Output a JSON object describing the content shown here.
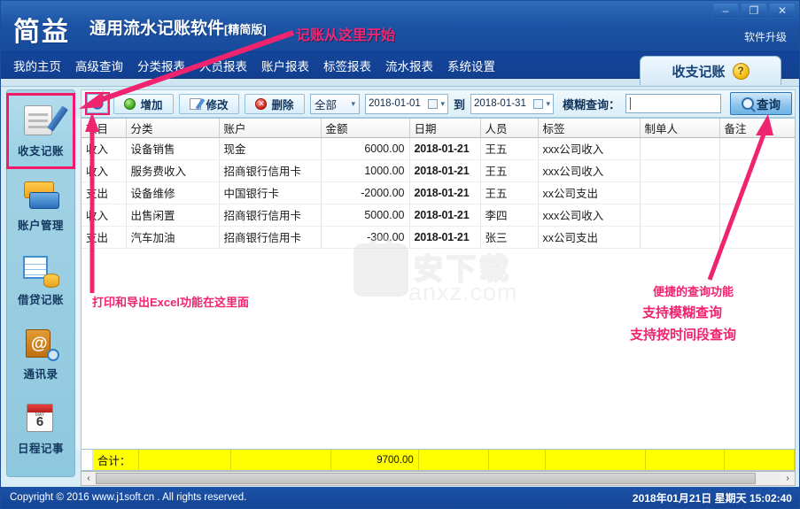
{
  "window": {
    "brand": "简益",
    "app_title": "通用流水记账软件",
    "app_title_suffix": "[精简版]",
    "upgrade_label": "软件升级",
    "minimize_icon": "–",
    "maximize_icon": "❐",
    "close_icon": "✕"
  },
  "menu": {
    "items": [
      {
        "label": "我的主页"
      },
      {
        "label": "高级查询"
      },
      {
        "label": "分类报表"
      },
      {
        "label": "人员报表"
      },
      {
        "label": "账户报表"
      },
      {
        "label": "标签报表"
      },
      {
        "label": "流水报表"
      },
      {
        "label": "系统设置"
      }
    ]
  },
  "tab": {
    "label": "收支记账",
    "help_glyph": "?"
  },
  "sidebar": {
    "items": [
      {
        "label": "收支记账",
        "icon": "notebook-pencil-icon",
        "active": true
      },
      {
        "label": "账户管理",
        "icon": "bank-cards-icon",
        "active": false
      },
      {
        "label": "借贷记账",
        "icon": "ledger-coins-icon",
        "active": false
      },
      {
        "label": "通讯录",
        "icon": "address-book-icon",
        "active": false
      },
      {
        "label": "日程记事",
        "icon": "calendar-icon",
        "active": false
      }
    ],
    "calendar_month": "MAY",
    "calendar_day": "6"
  },
  "toolbar": {
    "settings_icon": "gear-icon",
    "add_label": "增加",
    "edit_label": "修改",
    "delete_label": "删除",
    "delete_glyph": "✕",
    "filter_value": "全部",
    "date_from": "2018-01-01",
    "date_to": "2018-01-31",
    "between_label": "到",
    "fuzzy_label": "模糊查询：",
    "fuzzy_value": "",
    "fuzzy_placeholder": "",
    "query_label": "查询"
  },
  "grid": {
    "columns": [
      "项目",
      "分类",
      "账户",
      "金额",
      "日期",
      "人员",
      "标签",
      "制单人",
      "备注"
    ],
    "rows": [
      {
        "项目": "收入",
        "分类": "设备销售",
        "账户": "现金",
        "金额": "6000.00",
        "日期": "2018-01-21",
        "人员": "王五",
        "标签": "xxx公司收入",
        "制单人": "",
        "备注": ""
      },
      {
        "项目": "收入",
        "分类": "服务费收入",
        "账户": "招商银行信用卡",
        "金额": "1000.00",
        "日期": "2018-01-21",
        "人员": "王五",
        "标签": "xxx公司收入",
        "制单人": "",
        "备注": ""
      },
      {
        "项目": "支出",
        "分类": "设备维修",
        "账户": "中国银行卡",
        "金额": "-2000.00",
        "日期": "2018-01-21",
        "人员": "王五",
        "标签": "xx公司支出",
        "制单人": "",
        "备注": ""
      },
      {
        "项目": "收入",
        "分类": "出售闲置",
        "账户": "招商银行信用卡",
        "金额": "5000.00",
        "日期": "2018-01-21",
        "人员": "李四",
        "标签": "xxx公司收入",
        "制单人": "",
        "备注": ""
      },
      {
        "项目": "支出",
        "分类": "汽车加油",
        "账户": "招商银行信用卡",
        "金额": "-300.00",
        "日期": "2018-01-21",
        "人员": "张三",
        "标签": "xx公司支出",
        "制单人": "",
        "备注": ""
      }
    ]
  },
  "totals": {
    "label": "合计：",
    "amount": "9700.00"
  },
  "scrollbar": {
    "left_arrow": "‹",
    "right_arrow": "›"
  },
  "statusbar": {
    "copyright": "Copyright © 2016 www.j1soft.cn . All rights reserved.",
    "datetime": "2018年01月21日  星期天  15:02:40"
  },
  "annotations": {
    "start": "记账从这里开始",
    "export": "打印和导出Excel功能在这里面",
    "query_1": "便捷的查询功能",
    "query_2": "支持模糊查询",
    "query_3": "支持按时间段查询"
  },
  "watermark": {
    "cn": "安下载",
    "en": "anxz.com"
  },
  "colors": {
    "brand_blue": "#174a9a",
    "menu_blue": "#123f90",
    "accent_pink": "#f0246e",
    "totals_yellow": "#ffff00",
    "sidebar_blue": "#8ec8de"
  }
}
